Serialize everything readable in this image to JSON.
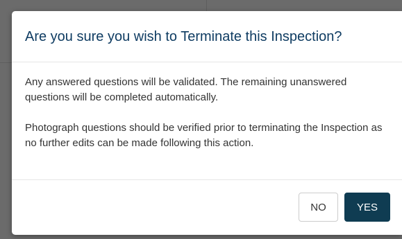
{
  "dialog": {
    "title": "Are you sure you wish to Terminate this Inspection?",
    "paragraphs": [
      "Any answered questions will be validated. The remaining unanswered questions will be completed automatically.",
      "Photograph questions should be verified prior to terminating the Inspection as no further edits can be made following this action."
    ],
    "buttons": {
      "no_label": "NO",
      "yes_label": "YES"
    }
  },
  "colors": {
    "title": "#0f3c62",
    "primary_button": "#0f3c52",
    "backdrop": "#6b6b6b"
  }
}
